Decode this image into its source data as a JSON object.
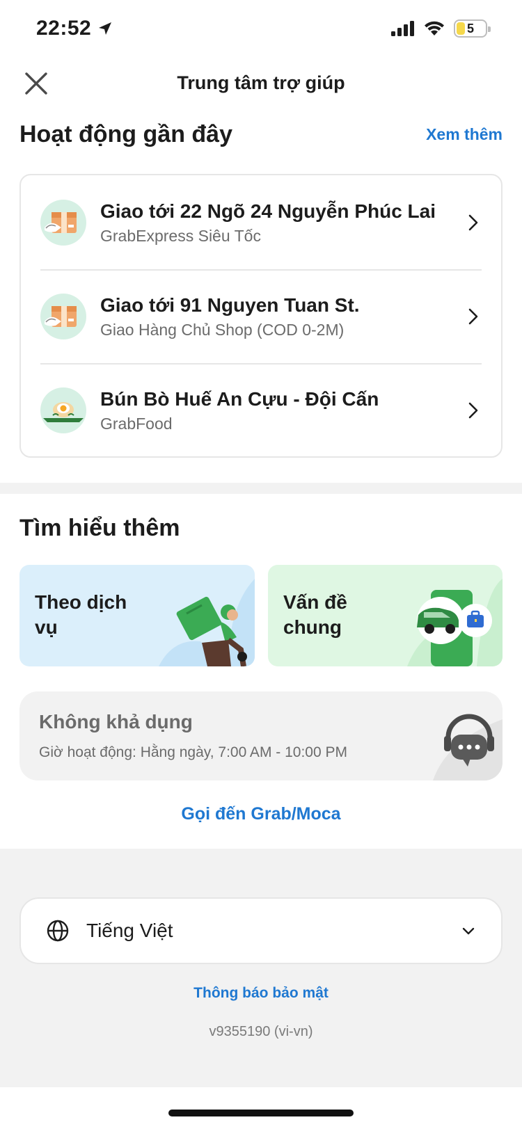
{
  "status_bar": {
    "time": "22:52",
    "battery": "5",
    "icons": [
      "location-arrow-icon",
      "signal-icon",
      "wifi-icon",
      "battery-icon"
    ]
  },
  "header": {
    "title": "Trung tâm trợ giúp",
    "close_icon": "close-icon"
  },
  "recent": {
    "title": "Hoạt động gần đây",
    "see_more": "Xem thêm",
    "items": [
      {
        "title": "Giao tới 22 Ngõ 24 Nguyễn Phúc Lai",
        "subtitle": "GrabExpress Siêu Tốc",
        "icon": "parcel-icon"
      },
      {
        "title": "Giao tới 91 Nguyen Tuan St.",
        "subtitle": "Giao Hàng Chủ Shop (COD 0-2M)",
        "icon": "parcel-icon"
      },
      {
        "title": "Bún Bò Huế An Cựu - Đội Cấn",
        "subtitle": "GrabFood",
        "icon": "food-icon"
      }
    ]
  },
  "learn_more": {
    "title": "Tìm hiểu thêm",
    "tiles": [
      {
        "label": "Theo dịch vụ",
        "icon": "delivery-rider-icon"
      },
      {
        "label": "Vấn đề chung",
        "icon": "car-briefcase-icon"
      }
    ]
  },
  "support": {
    "status": "Không khả dụng",
    "hours": "Giờ hoạt động: Hằng ngày, 7:00 AM - 10:00 PM",
    "icon": "chat-support-icon",
    "call_link": "Gọi đến Grab/Moca"
  },
  "footer": {
    "language": "Tiếng Việt",
    "privacy": "Thông báo bảo mật",
    "version": "v9355190 (vi-vn)"
  },
  "colors": {
    "link": "#1f78d1",
    "mint": "#d6f0e4",
    "blue_tile": "#dbeffb",
    "green_tile": "#dff7e3",
    "grab_green": "#3bab54"
  }
}
